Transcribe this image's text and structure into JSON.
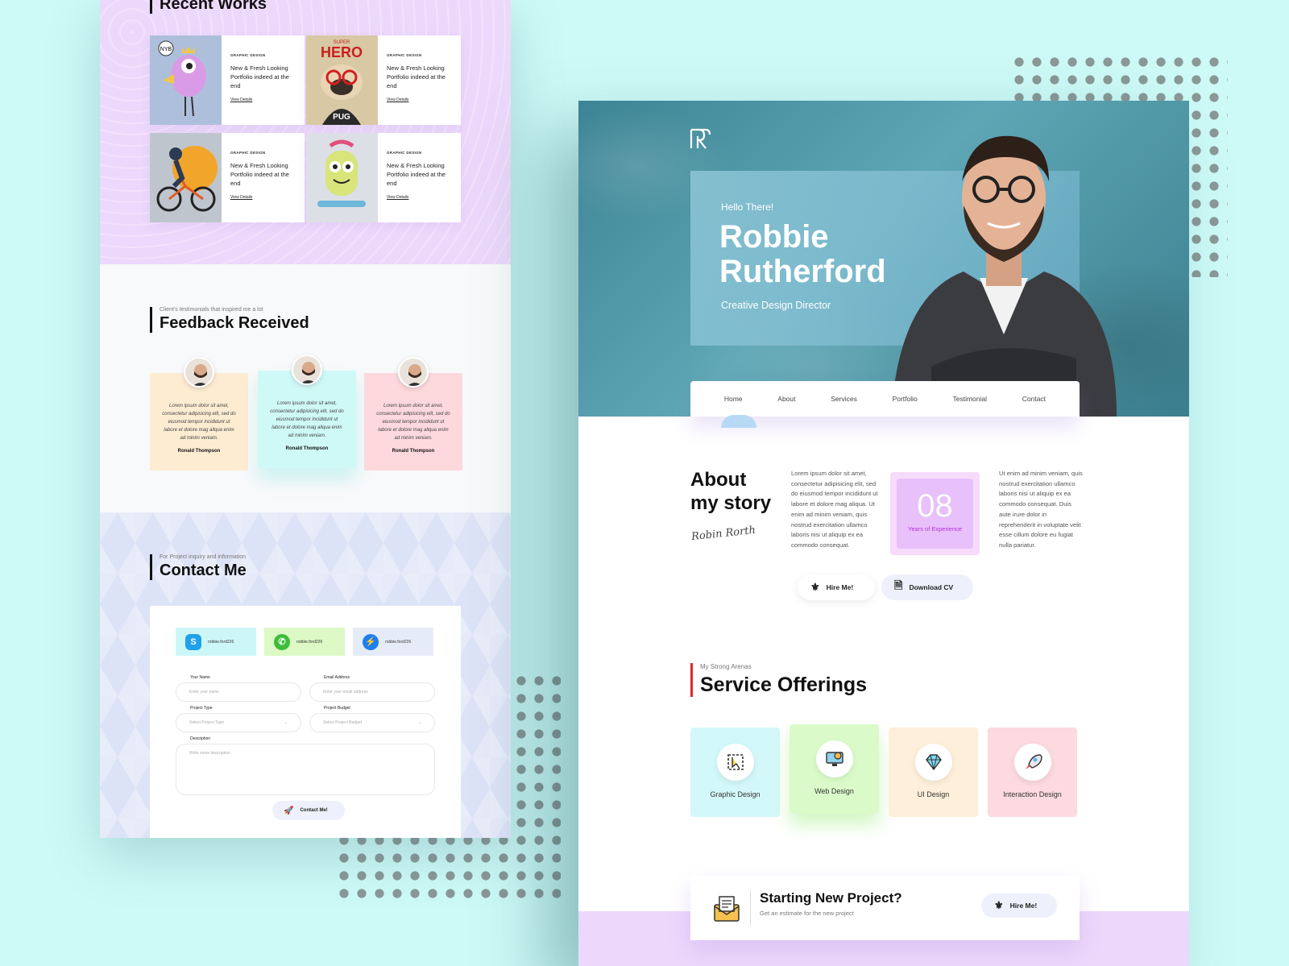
{
  "left": {
    "recent_works": {
      "title": "Recent Works",
      "items": [
        {
          "category": "GRAPHIC DESIGN",
          "title": "New & Fresh Looking Portfolio indeed at the end",
          "link": "View Details"
        },
        {
          "category": "GRAPHIC DESIGN",
          "title": "New & Fresh Looking Portfolio indeed at the end",
          "link": "View Details"
        },
        {
          "category": "GRAPHIC DESIGN",
          "title": "New & Fresh Looking Portfolio indeed at the end",
          "link": "View Details"
        },
        {
          "category": "GRAPHIC DESIGN",
          "title": "New & Fresh Looking Portfolio indeed at the end",
          "link": "View Details"
        }
      ],
      "art_texts": {
        "super": "SUPER",
        "hero": "HERO",
        "pug": "PUG",
        "nyb": "NYB"
      }
    },
    "feedback": {
      "subtitle": "Client's testimonials that inspired me a lot",
      "title": "Feedback Received",
      "items": [
        {
          "quote": "Lorem ipsum dolor sit amet, consectetur adipisicing elit, sed do eiusmod tempor incididunt ut labore et dolore mag aliqua enim ad minim veniam.",
          "name": "Ronald Thompson",
          "color": "#fdecd2"
        },
        {
          "quote": "Lorem ipsum dolor sit amet, consectetur adipisicing elit, sed do eiusmod tempor incididunt ut labore et dolore mag aliqua enim ad minim veniam.",
          "name": "Ronald Thompson",
          "color": "#cff9f7"
        },
        {
          "quote": "Lorem ipsum dolor sit amet, consectetur adipisicing elit, sed do eiusmod tempor incididunt ut labore et dolore mag aliqua enim ad minim veniam.",
          "name": "Ronald Thompson",
          "color": "#fdd9dd"
        }
      ]
    },
    "contact": {
      "subtitle": "For Project inquiry and information",
      "title": "Contact Me",
      "chips": [
        {
          "icon": "skype-icon",
          "handle": "robbie.ford226",
          "color": "#cdf6f9"
        },
        {
          "icon": "whatsapp-icon",
          "handle": "robbie.ford226",
          "color": "#dcf9c6"
        },
        {
          "icon": "messenger-icon",
          "handle": "robbie.ford226",
          "color": "#e6ecf7"
        }
      ],
      "fields": {
        "name_label": "Your Name",
        "name_placeholder": "Enter your name",
        "email_label": "Email Address",
        "email_placeholder": "Enter your email address",
        "type_label": "Project Type",
        "type_placeholder": "Select Project Type",
        "budget_label": "Project Budget",
        "budget_placeholder": "Select Project Budget",
        "desc_label": "Description",
        "desc_placeholder": "Write some description"
      },
      "submit": "Contact Me!"
    }
  },
  "right": {
    "hero": {
      "greeting": "Hello There!",
      "first_name": "Robbie",
      "last_name": "Rutherford",
      "role": "Creative Design Director"
    },
    "nav": [
      "Home",
      "About",
      "Services",
      "Portfolio",
      "Testimonial",
      "Contact"
    ],
    "about": {
      "title_line1": "About",
      "title_line2": "my story",
      "signature": "Robin Rorth",
      "col1": "Lorem ipsum dolor sit amet, consectetur adipisicing elit, sed do eiusmod tempor incididunt ut labore et dolore mag aliqua. Ut enim ad minim veniam, quis nostrud exercitation ullamco laboris nisi ut aliquip ex ea commodo consequat.",
      "col2": "Ut enim ad minim veniam, quis nostrud exercitation ullamco laboris nisi ut aliquip ex ea commodo consequat. Duis aute irure dolor in reprehenderit in voluptate velit esse cillum dolore eu fugiat nulla pariatur.",
      "years": "08",
      "years_label": "Years of Experience"
    },
    "buttons": {
      "hire": "Hire Me!",
      "cv": "Download CV"
    },
    "services": {
      "subtitle": "My Strong Arenas",
      "title": "Service Offerings",
      "items": [
        {
          "label": "Graphic Design",
          "icon": "graphic-design-icon",
          "color": "#d3f8f9"
        },
        {
          "label": "Web Design",
          "icon": "web-design-icon",
          "color": "#dafbc9"
        },
        {
          "label": "UI Design",
          "icon": "diamond-icon",
          "color": "#fdefd9"
        },
        {
          "label": "Interaction Design",
          "icon": "rocket-icon",
          "color": "#fcdadf"
        }
      ]
    },
    "cta": {
      "title": "Starting New Project?",
      "subtitle": "Get an estimate for the new project",
      "button": "Hire Me!"
    }
  }
}
